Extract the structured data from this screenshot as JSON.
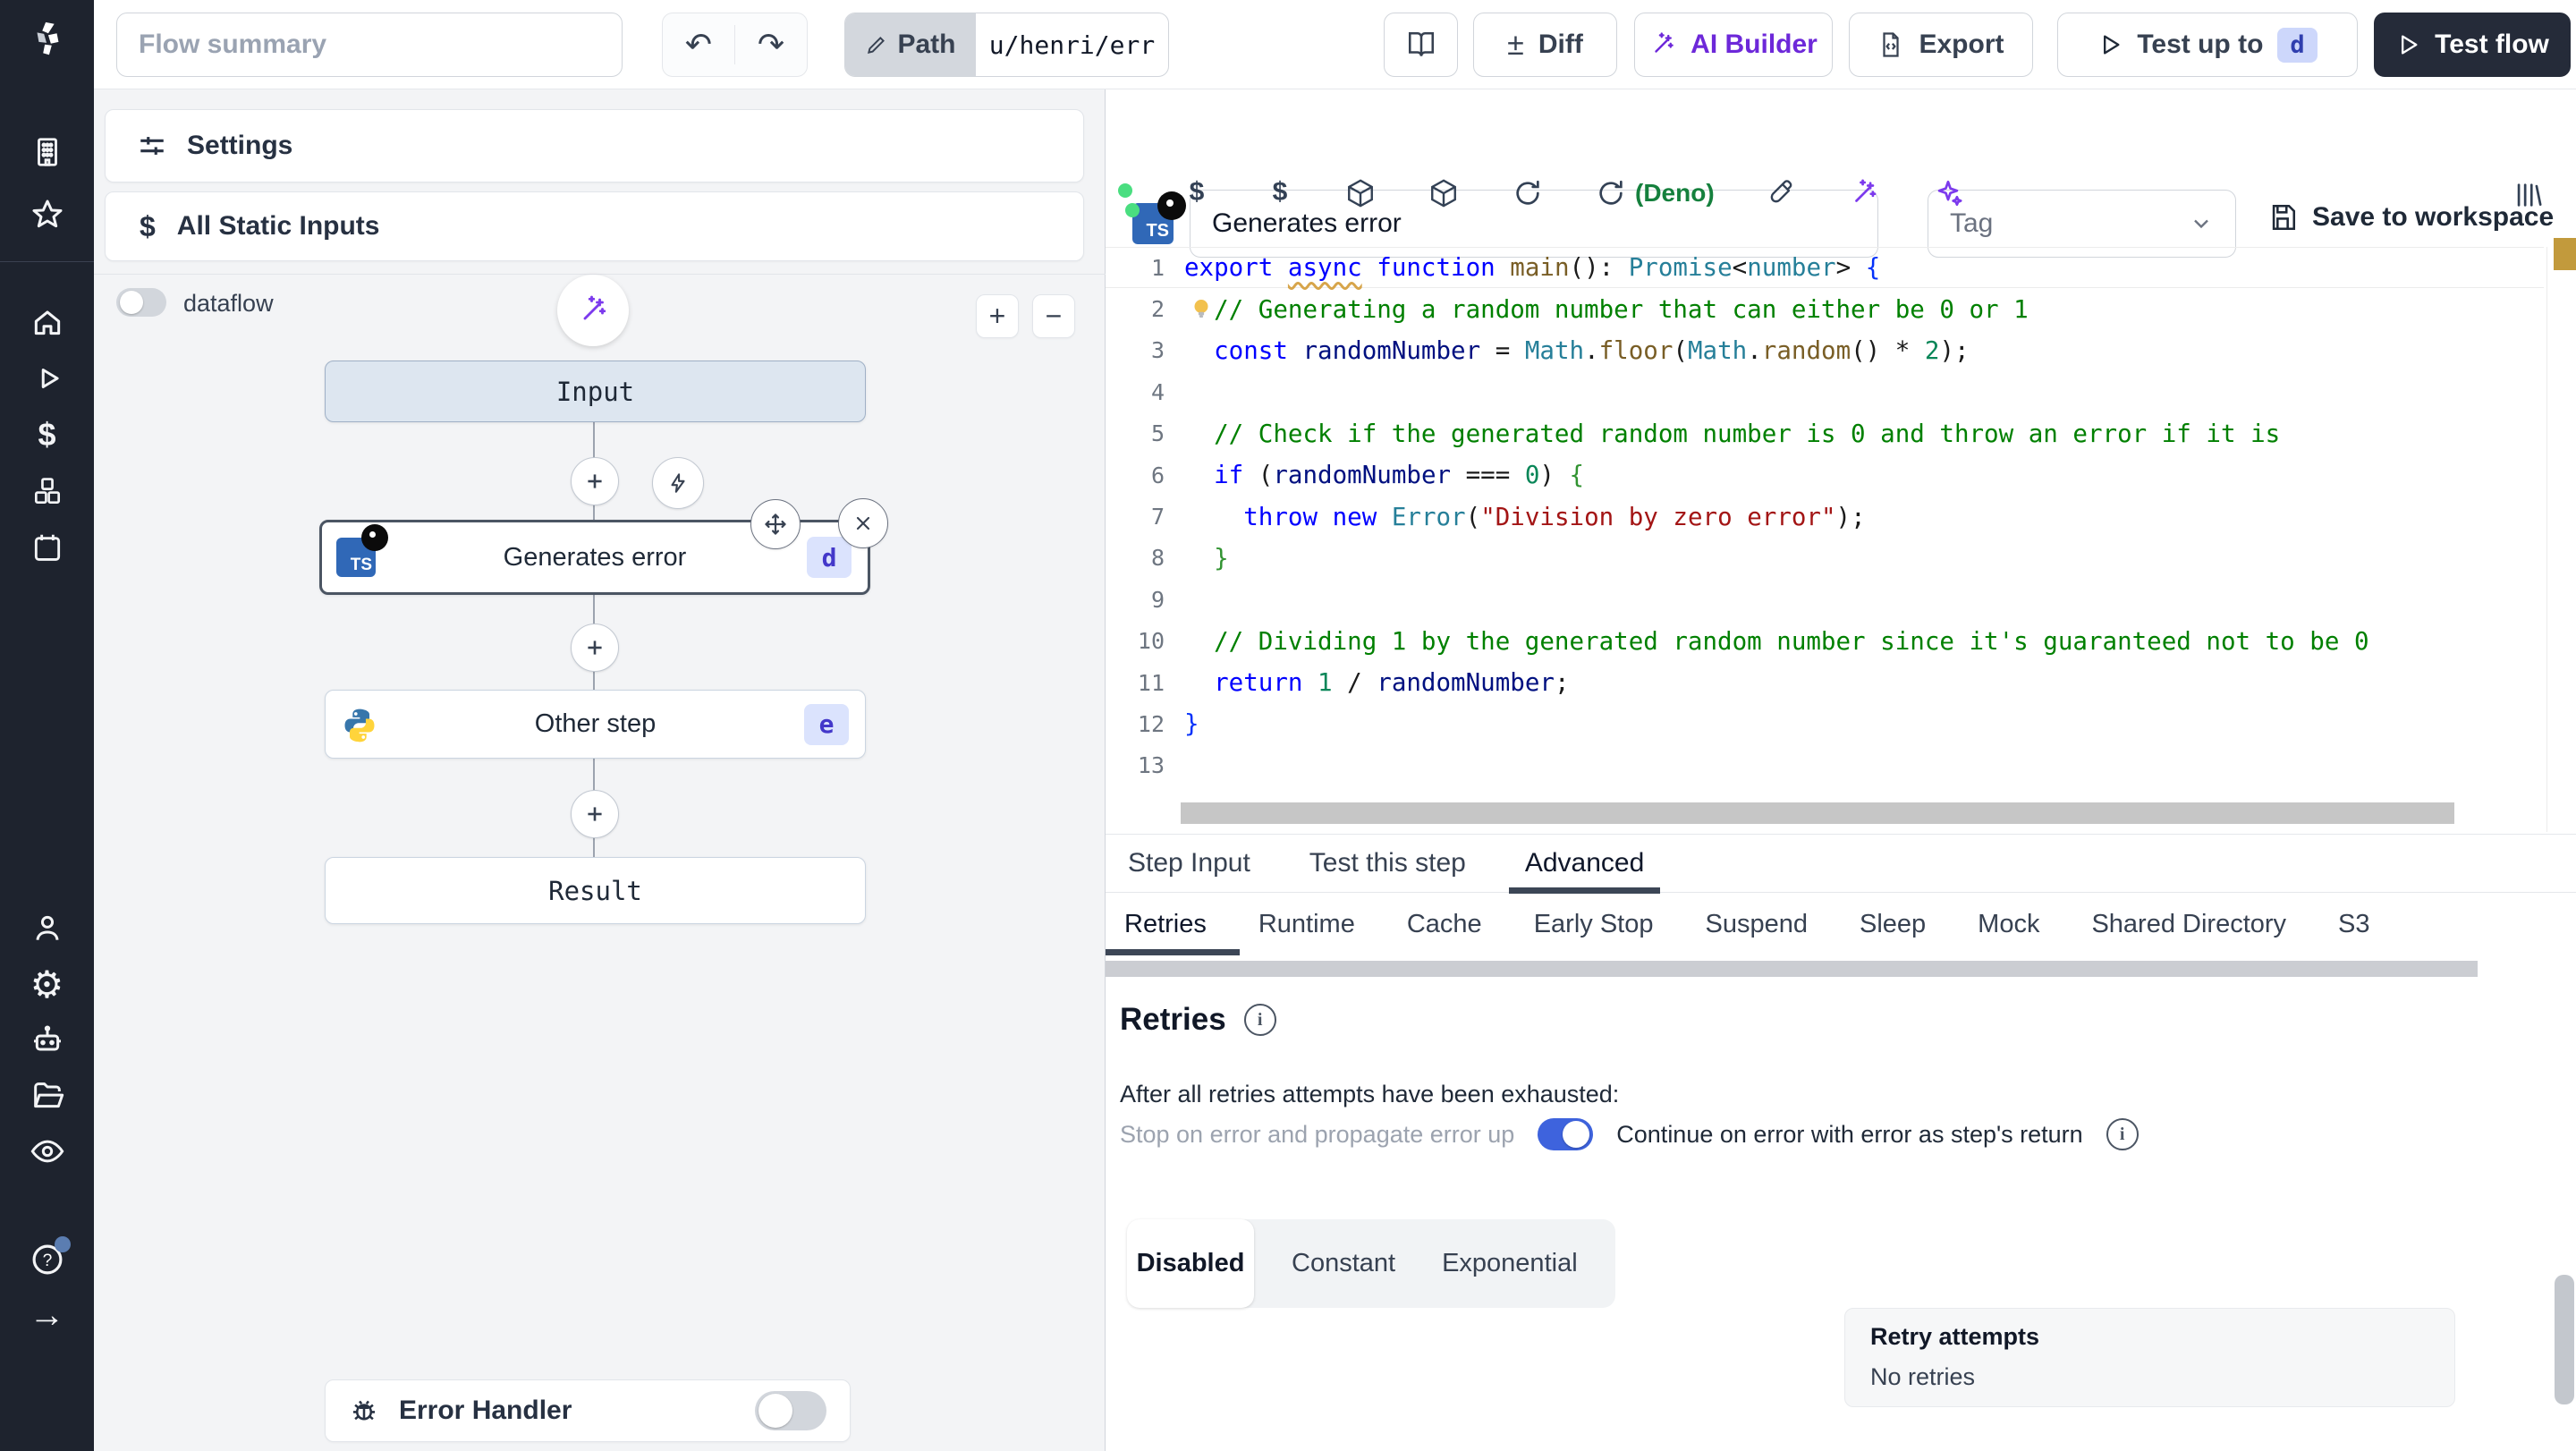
{
  "colors": {
    "accent_blue": "#3e63dd",
    "ai_purple": "#6d28d9",
    "dark_button": "#252b39",
    "badge_bg": "#dbe3fd",
    "badge_text": "#4338ca",
    "deno_green": "#15803d"
  },
  "topbar": {
    "flow_summary_placeholder": "Flow summary",
    "path_label": "Path",
    "path_value": "u/henri/err",
    "diff_glyph": "±",
    "diff_label": "Diff",
    "ai_builder_label": "AI Builder",
    "export_label": "Export",
    "test_up_to_label": "Test up to",
    "test_up_to_badge": "d",
    "test_flow_label": "Test flow",
    "undo_glyph": "↶",
    "redo_glyph": "↷"
  },
  "flow": {
    "settings_label": "Settings",
    "static_inputs_label": "All Static Inputs",
    "static_inputs_glyph": "$",
    "dataflow_label": "dataflow",
    "zoom_in": "+",
    "zoom_out": "−",
    "nodes": {
      "input": "Input",
      "step1": {
        "title": "Generates error",
        "badge": "d"
      },
      "step2": {
        "title": "Other step",
        "badge": "e"
      },
      "result": "Result"
    },
    "error_handler_label": "Error Handler"
  },
  "editor": {
    "step_name": "Generates error",
    "tag_placeholder": "Tag",
    "save_label": "Save to workspace",
    "deno_label": "(Deno)",
    "ts_label": "TS",
    "dollar_glyph": "$",
    "code": {
      "lines": [
        {
          "n": 1,
          "tokens": [
            [
              "kw",
              "export "
            ],
            [
              "kw sq",
              "async"
            ],
            [
              "pl",
              " "
            ],
            [
              "kw",
              "function "
            ],
            [
              "fn",
              "main"
            ],
            [
              "pl",
              "(): "
            ],
            [
              "ty",
              "Promise"
            ],
            [
              "pl",
              "<"
            ],
            [
              "ty",
              "number"
            ],
            [
              "pl",
              "> "
            ],
            [
              "b1",
              "{"
            ]
          ]
        },
        {
          "n": 2,
          "bulb": true,
          "tokens": [
            [
              "pl",
              "  "
            ],
            [
              "cm",
              "// Generating a random number that can either be 0 or 1"
            ]
          ]
        },
        {
          "n": 3,
          "tokens": [
            [
              "pl",
              "  "
            ],
            [
              "kw",
              "const"
            ],
            [
              "vr",
              " randomNumber"
            ],
            [
              "pl",
              " = "
            ],
            [
              "ty",
              "Math"
            ],
            [
              "pl",
              "."
            ],
            [
              "fn",
              "floor"
            ],
            [
              "pl",
              "("
            ],
            [
              "ty",
              "Math"
            ],
            [
              "pl",
              "."
            ],
            [
              "fn",
              "random"
            ],
            [
              "pl",
              "() * "
            ],
            [
              "nu",
              "2"
            ],
            [
              "pl",
              ");"
            ]
          ]
        },
        {
          "n": 4,
          "tokens": []
        },
        {
          "n": 5,
          "tokens": [
            [
              "pl",
              "  "
            ],
            [
              "cm",
              "// Check if the generated random number is 0 and throw an error if it is"
            ]
          ]
        },
        {
          "n": 6,
          "tokens": [
            [
              "pl",
              "  "
            ],
            [
              "kw",
              "if"
            ],
            [
              "pl",
              " ("
            ],
            [
              "vr",
              "randomNumber"
            ],
            [
              "pl",
              " === "
            ],
            [
              "nu",
              "0"
            ],
            [
              "pl",
              ") "
            ],
            [
              "b2",
              "{"
            ]
          ]
        },
        {
          "n": 7,
          "tokens": [
            [
              "pl",
              "    "
            ],
            [
              "kw",
              "throw"
            ],
            [
              "pl",
              " "
            ],
            [
              "kw",
              "new"
            ],
            [
              "pl",
              " "
            ],
            [
              "ty",
              "Error"
            ],
            [
              "pl",
              "("
            ],
            [
              "st",
              "\"Division by zero error\""
            ],
            [
              "pl",
              ");"
            ]
          ]
        },
        {
          "n": 8,
          "tokens": [
            [
              "pl",
              "  "
            ],
            [
              "b2",
              "}"
            ]
          ]
        },
        {
          "n": 9,
          "tokens": []
        },
        {
          "n": 10,
          "tokens": [
            [
              "pl",
              "  "
            ],
            [
              "cm",
              "// Dividing 1 by the generated random number since it's guaranteed not to be 0"
            ]
          ]
        },
        {
          "n": 11,
          "tokens": [
            [
              "pl",
              "  "
            ],
            [
              "kw",
              "return"
            ],
            [
              "pl",
              " "
            ],
            [
              "nu",
              "1"
            ],
            [
              "pl",
              " / "
            ],
            [
              "vr",
              "randomNumber"
            ],
            [
              "pl",
              ";"
            ]
          ]
        },
        {
          "n": 12,
          "tokens": [
            [
              "b1",
              "}"
            ]
          ]
        },
        {
          "n": 13,
          "tokens": []
        }
      ]
    }
  },
  "tabs": {
    "items": [
      "Step Input",
      "Test this step",
      "Advanced"
    ],
    "active": "Advanced"
  },
  "subtabs": {
    "items": [
      "Retries",
      "Runtime",
      "Cache",
      "Early Stop",
      "Suspend",
      "Sleep",
      "Mock",
      "Shared Directory",
      "S3"
    ],
    "active": "Retries"
  },
  "retries": {
    "title": "Retries",
    "exhausted_label": "After all retries attempts have been exhausted:",
    "stop_label": "Stop on error and propagate error up",
    "continue_label": "Continue on error with error as step's return",
    "modes": [
      "Disabled",
      "Constant",
      "Exponential"
    ],
    "attempts_title": "Retry attempts",
    "attempts_value": "No retries"
  }
}
